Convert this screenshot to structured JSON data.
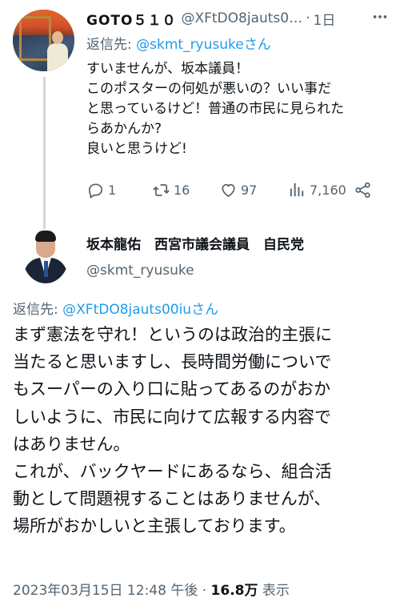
{
  "reply_tweet": {
    "display_name": "GOTO５１０",
    "handle": "@XFtDO8jauts0…",
    "separator": "·",
    "time": "1日",
    "reply_prefix": "返信先:",
    "reply_mention": "@skmt_ryusukeさん",
    "body_lines": [
      "すいませんが、坂本議員！",
      "このポスターの何処が悪いの？いい事だ",
      "と思っているけど！普通の市民に見られた",
      "らあかんか?",
      "良いと思うけど!"
    ],
    "stats": {
      "replies": "1",
      "retweets": "16",
      "likes": "97",
      "views": "7,160"
    },
    "icons": {
      "more": "more-dots-icon",
      "reply": "reply-bubble-icon",
      "retweet": "retweet-icon",
      "like": "heart-icon",
      "views": "views-bar-chart-icon",
      "share": "share-icon"
    }
  },
  "main_tweet": {
    "display_name": "坂本龍佑　西宮市議会議員　自民党",
    "handle": "@skmt_ryusuke",
    "reply_prefix": "返信先:",
    "reply_mention": "@XFtDO8jauts00iuさん",
    "body_lines": [
      "まず憲法を守れ！というのは政治的主張に",
      "当たると思いますし、長時間労働についで",
      "もスーパーの入り口に貼ってあるのがおか",
      "しいように、市民に向けて広報する内容で",
      "はありません。",
      "これが、バックヤードにあるなら、組合活",
      "動として問題視することはありませんが、",
      "場所がおかしいと主張しております。"
    ],
    "timestamp": "2023年03月15日 12:48 午後",
    "separator": "·",
    "views_count": "16.8万",
    "views_label": "表示"
  },
  "colors": {
    "text": "#0f1419",
    "secondary": "#536471",
    "link": "#1d9bf0",
    "thread_line": "#cfd9de"
  }
}
